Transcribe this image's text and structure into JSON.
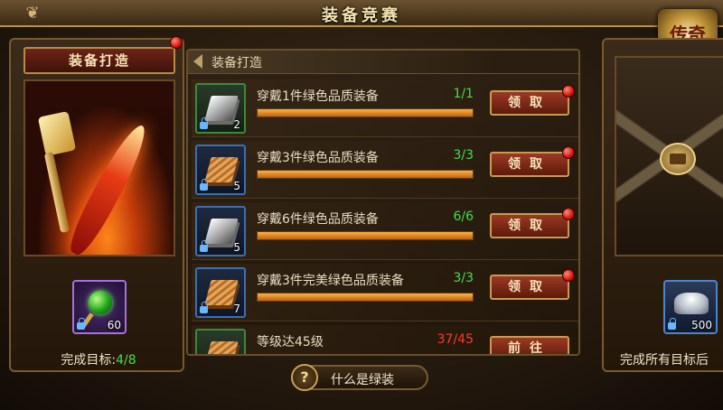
{
  "title": "装备竞赛",
  "logo_text": "传奇",
  "left_panel": {
    "header": "装备打造",
    "reward": {
      "icon": "green-gem-staff",
      "count": "60"
    },
    "goal_label": "完成目标:",
    "goal_progress": "4/8"
  },
  "center": {
    "header": "装备打造",
    "tasks": [
      {
        "icon": "silver-ingots-icon",
        "count": "2",
        "text": "穿戴1件绿色品质装备",
        "progress": "1/1",
        "progress_fraction": 1.0,
        "button": "领取",
        "status_color": "#3fe04a"
      },
      {
        "icon": "wood-material-icon",
        "count": "5",
        "text": "穿戴3件绿色品质装备",
        "progress": "3/3",
        "progress_fraction": 1.0,
        "button": "领取",
        "status_color": "#3fe04a"
      },
      {
        "icon": "silver-ingots-icon",
        "count": "5",
        "text": "穿戴6件绿色品质装备",
        "progress": "6/6",
        "progress_fraction": 1.0,
        "button": "领取",
        "status_color": "#3fe04a"
      },
      {
        "icon": "wood-material-icon",
        "count": "7",
        "text": "穿戴3件完美绿色品质装备",
        "progress": "3/3",
        "progress_fraction": 1.0,
        "button": "领取",
        "status_color": "#3fe04a"
      },
      {
        "icon": "wood-material-icon",
        "count": "",
        "text": "等级达45级",
        "progress": "37/45",
        "progress_fraction": 0.82,
        "button": "前往",
        "status_color": "#ff3a2a"
      }
    ]
  },
  "right_panel": {
    "reward": {
      "icon": "silver-ingot-icon",
      "count": "500"
    },
    "goal_label": "完成所有目标后"
  },
  "bottom": {
    "help_glyph": "?",
    "what_label": "什么是绿装"
  }
}
